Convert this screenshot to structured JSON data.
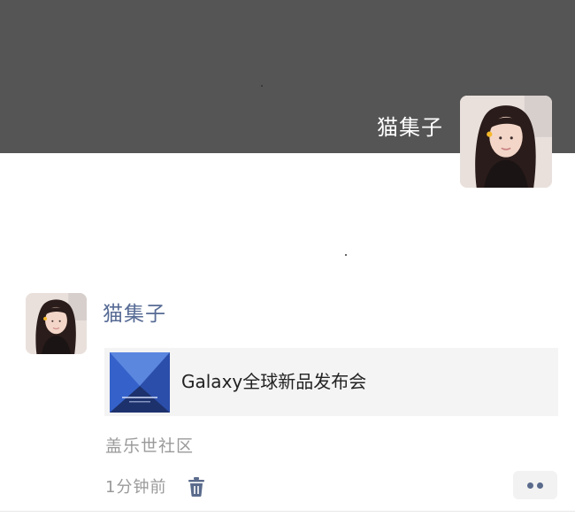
{
  "cover": {
    "user_name": "猫集子"
  },
  "post": {
    "author": "猫集子",
    "share": {
      "title": "Galaxy全球新品发布会",
      "thumbnail_icon": "galaxy-event-thumbnail"
    },
    "source": "盖乐世社区",
    "time": "1分钟前"
  },
  "icons": {
    "delete": "trash-icon",
    "more": "more-dots-icon"
  },
  "colors": {
    "cover_background": "#555555",
    "author_name": "#576b95",
    "meta_text": "#9a9a9a",
    "card_background": "#f4f4f4"
  }
}
